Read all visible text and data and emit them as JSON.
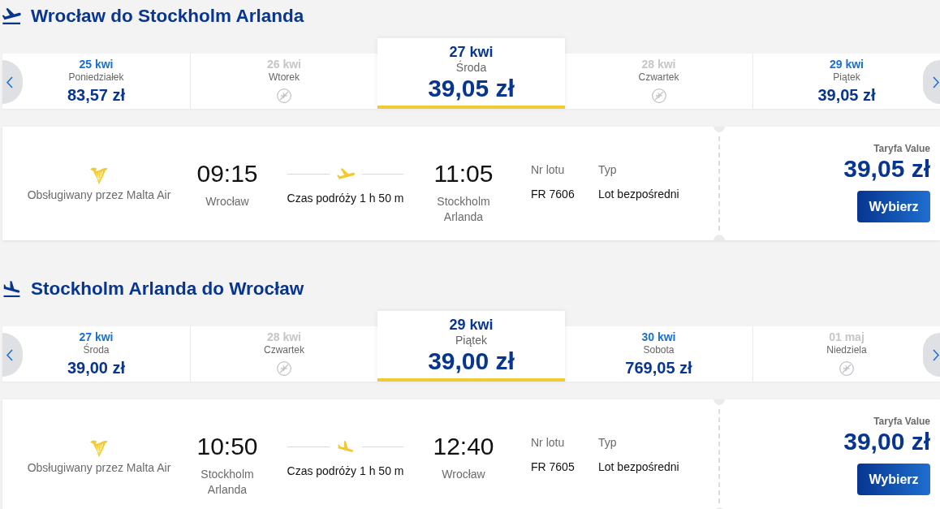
{
  "sections": [
    {
      "kind": "outbound",
      "title": "Wrocław do Stockholm Arlanda",
      "dates": [
        {
          "date": "25 kwi",
          "day": "Poniedziałek",
          "price": "83,57 zł",
          "available": true,
          "selected": false
        },
        {
          "date": "26 kwi",
          "day": "Wtorek",
          "available": false,
          "selected": false
        },
        {
          "date": "27 kwi",
          "day": "Środa",
          "price": "39,05 zł",
          "available": true,
          "selected": true
        },
        {
          "date": "28 kwi",
          "day": "Czwartek",
          "available": false,
          "selected": false
        },
        {
          "date": "29 kwi",
          "day": "Piątek",
          "price": "39,05 zł",
          "available": true,
          "selected": false
        }
      ],
      "flight": {
        "operator": "Obsługiwany przez Malta Air",
        "departure_time": "09:15",
        "departure_city": "Wrocław",
        "duration": "Czas podróży 1 h 50 m",
        "arrival_time": "11:05",
        "arrival_city": "Stockholm Arlanda",
        "flight_number_label": "Nr lotu",
        "flight_number": "FR 7606",
        "type_label": "Typ",
        "type": "Lot bezpośredni",
        "fare_label": "Taryfa Value",
        "price": "39,05 zł",
        "button": "Wybierz"
      }
    },
    {
      "kind": "return",
      "title": "Stockholm Arlanda do Wrocław",
      "dates": [
        {
          "date": "27 kwi",
          "day": "Środa",
          "price": "39,00 zł",
          "available": true,
          "selected": false
        },
        {
          "date": "28 kwi",
          "day": "Czwartek",
          "available": false,
          "selected": false
        },
        {
          "date": "29 kwi",
          "day": "Piątek",
          "price": "39,00 zł",
          "available": true,
          "selected": true
        },
        {
          "date": "30 kwi",
          "day": "Sobota",
          "price": "769,05 zł",
          "available": true,
          "selected": false
        },
        {
          "date": "01 maj",
          "day": "Niedziela",
          "available": false,
          "selected": false
        }
      ],
      "flight": {
        "operator": "Obsługiwany przez Malta Air",
        "departure_time": "10:50",
        "departure_city": "Stockholm Arlanda",
        "duration": "Czas podróży 1 h 50 m",
        "arrival_time": "12:40",
        "arrival_city": "Wrocław",
        "flight_number_label": "Nr lotu",
        "flight_number": "FR 7605",
        "type_label": "Typ",
        "type": "Lot bezpośredni",
        "fare_label": "Taryfa Value",
        "price": "39,00 zł",
        "button": "Wybierz"
      }
    }
  ]
}
